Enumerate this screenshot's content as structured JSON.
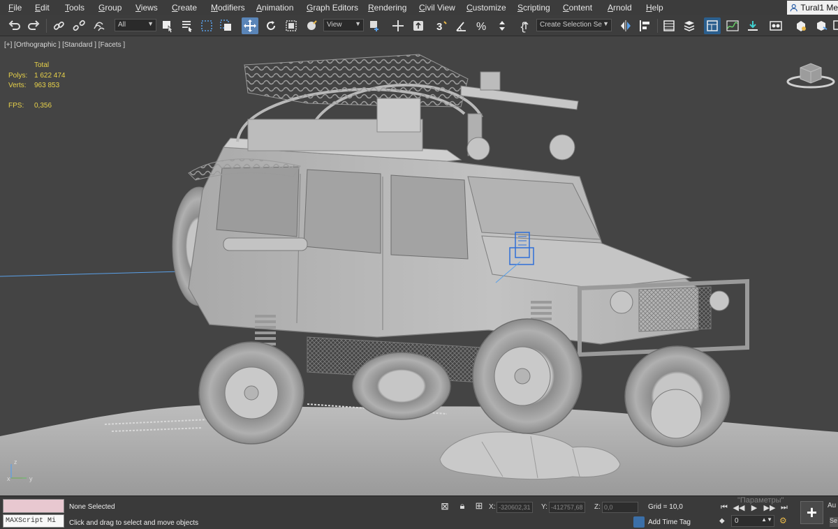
{
  "menu": {
    "items": [
      "File",
      "Edit",
      "Tools",
      "Group",
      "Views",
      "Create",
      "Modifiers",
      "Animation",
      "Graph Editors",
      "Rendering",
      "Civil View",
      "Customize",
      "Scripting",
      "Content",
      "Arnold",
      "Help"
    ],
    "user": "Tural1 Me"
  },
  "toolbar": {
    "filter_value": "All",
    "ref_coord_value": "View",
    "selection_set_placeholder": "Create Selection Se",
    "icons": [
      "undo-icon",
      "redo-icon",
      "link-icon",
      "unlink-icon",
      "bind-spacewarp-icon",
      "select-object-icon",
      "select-by-name-icon",
      "rect-selection-icon",
      "window-crossing-icon",
      "select-move-icon",
      "select-rotate-icon",
      "select-scale-icon",
      "placement-icon",
      "pivot-icon",
      "keyboard-shortcut-icon",
      "snap-3d-icon",
      "angle-snap-icon",
      "percent-snap-icon",
      "spinner-snap-icon",
      "edit-named-sets-icon",
      "mirror-icon",
      "align-icon",
      "layer-explorer-icon",
      "layer-icon",
      "scene-explorer-icon",
      "curve-editor-icon",
      "schematic-icon",
      "material-editor-icon",
      "render-setup-icon",
      "render-icon"
    ]
  },
  "viewport": {
    "label": "[+] [Orthographic ] [Standard ] [Facets ]",
    "stats": {
      "header": "Total",
      "polys_label": "Polys:",
      "polys_value": "1 622 474",
      "verts_label": "Verts:",
      "verts_value": "963 853",
      "fps_label": "FPS:",
      "fps_value": "0,356"
    },
    "axis": {
      "x": "x",
      "y": "y",
      "z": "z"
    },
    "colors": {
      "background": "#444444",
      "stats_text": "#e8d24a",
      "selection_gizmo": "#2f6fd8",
      "model": "#b8b8b8"
    }
  },
  "status": {
    "maxscript_placeholder": "MAXScript Mi",
    "selection": "None Selected",
    "prompt": "Click and drag to select and move objects",
    "x_label": "X:",
    "x_value": "-320602,31",
    "y_label": "Y:",
    "y_value": "-412757,68",
    "z_label": "Z:",
    "z_value": "0,0",
    "grid": "Grid = 10,0",
    "add_time_tag": "Add Time Tag",
    "frame_value": "0",
    "params_ghost": "\"Параметры\"",
    "auto_label": "Au",
    "set_label": "Se"
  }
}
